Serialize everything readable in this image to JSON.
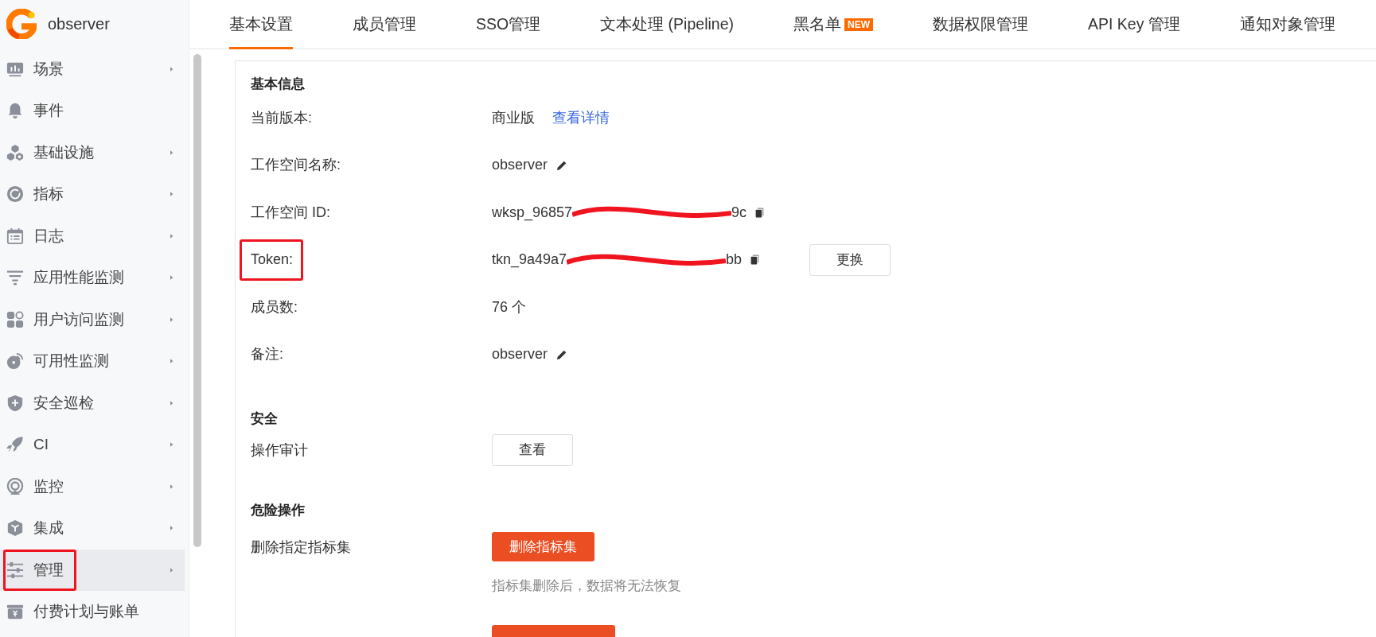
{
  "app": {
    "name": "observer"
  },
  "sidebar": {
    "items": [
      {
        "label": "场景",
        "has_submenu": true,
        "selected": false,
        "highlighted": false
      },
      {
        "label": "事件",
        "has_submenu": false,
        "selected": false,
        "highlighted": false
      },
      {
        "label": "基础设施",
        "has_submenu": true,
        "selected": false,
        "highlighted": false
      },
      {
        "label": "指标",
        "has_submenu": true,
        "selected": false,
        "highlighted": false
      },
      {
        "label": "日志",
        "has_submenu": true,
        "selected": false,
        "highlighted": false
      },
      {
        "label": "应用性能监测",
        "has_submenu": true,
        "selected": false,
        "highlighted": false
      },
      {
        "label": "用户访问监测",
        "has_submenu": true,
        "selected": false,
        "highlighted": false
      },
      {
        "label": "可用性监测",
        "has_submenu": true,
        "selected": false,
        "highlighted": false
      },
      {
        "label": "安全巡检",
        "has_submenu": true,
        "selected": false,
        "highlighted": false
      },
      {
        "label": "CI",
        "has_submenu": true,
        "selected": false,
        "highlighted": false
      },
      {
        "label": "监控",
        "has_submenu": true,
        "selected": false,
        "highlighted": false
      },
      {
        "label": "集成",
        "has_submenu": true,
        "selected": false,
        "highlighted": false
      },
      {
        "label": "管理",
        "has_submenu": true,
        "selected": true,
        "highlighted": true
      },
      {
        "label": "付费计划与账单",
        "has_submenu": false,
        "selected": false,
        "highlighted": false
      }
    ]
  },
  "tabs": [
    {
      "label": "基本设置",
      "selected": true
    },
    {
      "label": "成员管理",
      "selected": false
    },
    {
      "label": "SSO管理",
      "selected": false
    },
    {
      "label": "文本处理 (Pipeline)",
      "selected": false
    },
    {
      "label": "黑名单",
      "selected": false,
      "badge": "NEW"
    },
    {
      "label": "数据权限管理",
      "selected": false
    },
    {
      "label": "API Key 管理",
      "selected": false
    },
    {
      "label": "通知对象管理",
      "selected": false
    }
  ],
  "basic_info": {
    "heading": "基本信息",
    "rows": [
      {
        "kind": "link",
        "label": "当前版本:",
        "value": "商业版",
        "link": "查看详情",
        "highlighted": false
      },
      {
        "kind": "edit",
        "label": "工作空间名称:",
        "value": "observer",
        "highlighted": false
      },
      {
        "kind": "secret",
        "label": "工作空间 ID:",
        "value": "wksp_96857",
        "value_end": "9c",
        "highlighted": false
      },
      {
        "kind": "secret",
        "label": "Token:",
        "value": "tkn_9a49a7",
        "value_end": "bb",
        "button": "更换",
        "highlighted": true
      },
      {
        "kind": "plain",
        "label": "成员数:",
        "value": "76 个",
        "highlighted": false
      },
      {
        "kind": "edit",
        "label": "备注:",
        "value": "observer",
        "highlighted": false
      }
    ]
  },
  "security": {
    "heading": "安全",
    "rows": [
      {
        "label": "操作审计",
        "button": "查看"
      }
    ]
  },
  "danger": {
    "heading": "危险操作",
    "rows": [
      {
        "kind": "button",
        "label": "删除指定指标集",
        "button": "删除指标集",
        "hint": "指标集删除后，数据将无法恢复"
      },
      {
        "kind": "cut"
      }
    ]
  }
}
